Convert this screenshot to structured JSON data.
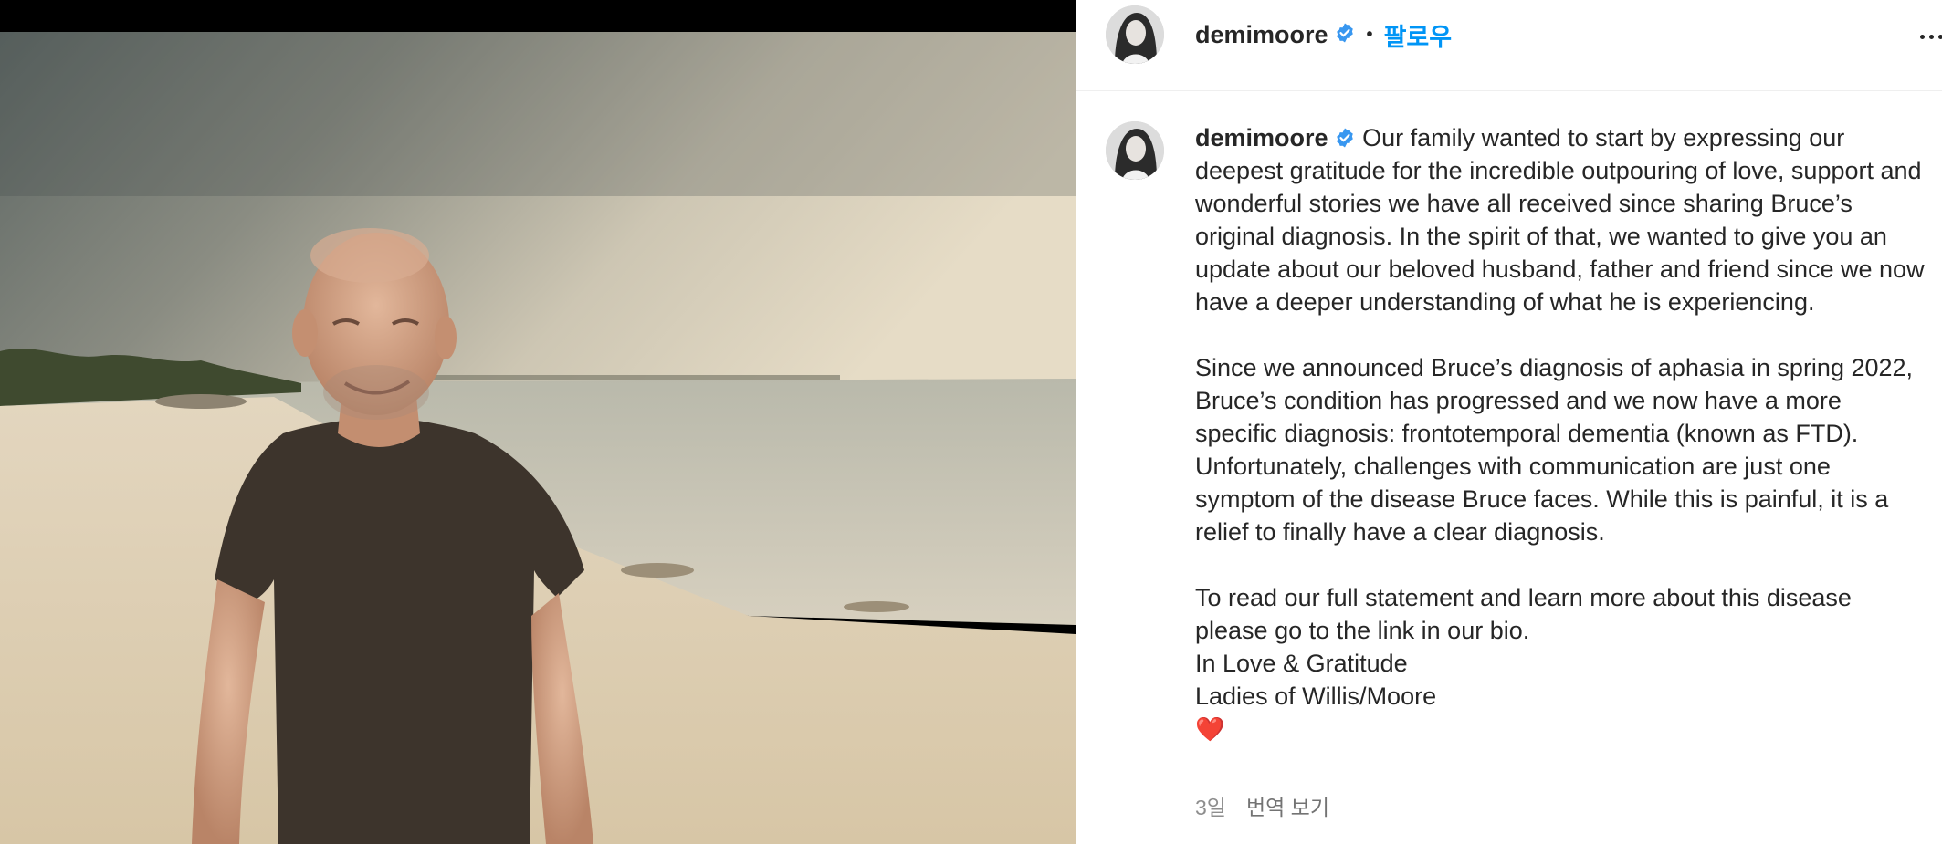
{
  "post": {
    "username": "demimoore",
    "follow_label": "팔로우",
    "separator": "•",
    "caption": {
      "username": "demimoore",
      "paragraphs": [
        "Our family wanted to start by expressing our deepest gratitude for the incredible outpouring of love, support and wonderful stories we have all received since sharing Bruce’s original diagnosis. In the spirit of that, we wanted to give you an update about our beloved husband, father and friend since we now have a deeper understanding of what he is experiencing.",
        "Since we announced Bruce’s diagnosis of aphasia in spring 2022, Bruce’s condition has progressed and we now have a more specific diagnosis: frontotemporal dementia (known as FTD). Unfortunately, challenges with communication are just one symptom of the disease Bruce faces. While this is painful, it is a relief to finally have a clear diagnosis."
      ],
      "closing_lines": [
        "To read our full statement and learn more about this disease please go to the link in our bio.",
        "In Love & Gratitude",
        "Ladies of Willis/Moore"
      ],
      "heart": "❤️"
    },
    "time_ago": "3일",
    "translate_label": "번역 보기"
  },
  "icons": {
    "verified": "verified-badge-icon",
    "more": "more-options-icon",
    "avatar": "profile-avatar"
  },
  "colors": {
    "accent": "#0095f6",
    "verified": "#3897f0",
    "text": "#262626",
    "muted": "#8e8e8e",
    "heart": "#e0245e"
  }
}
